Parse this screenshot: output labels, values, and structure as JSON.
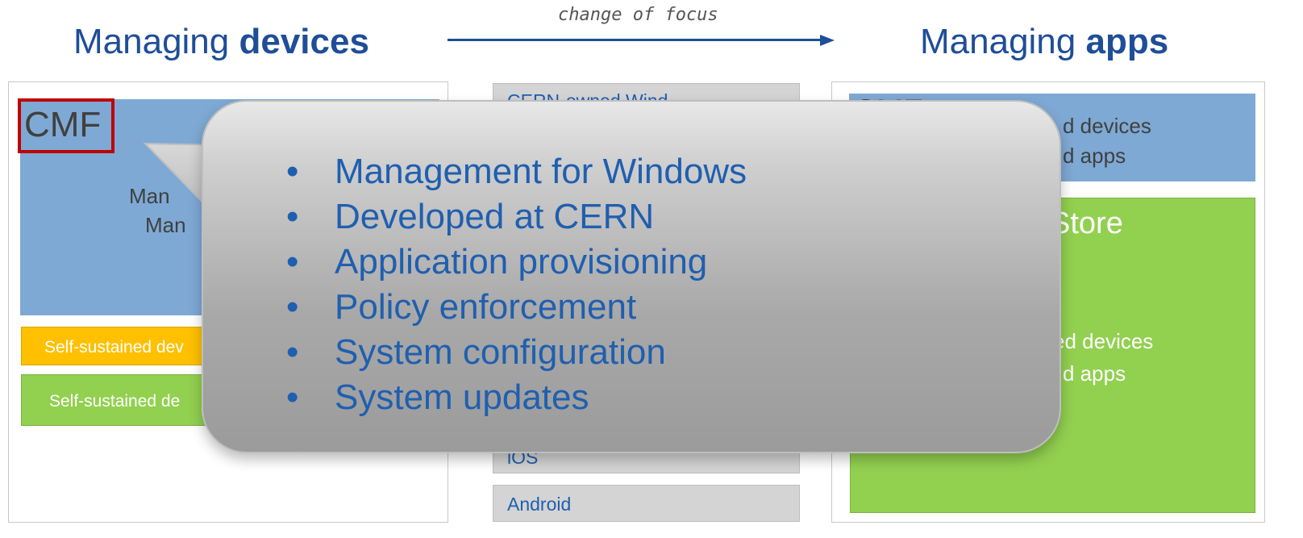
{
  "header": {
    "left_prefix": "Managing ",
    "left_bold": "devices",
    "right_prefix": "Managing ",
    "right_bold": "apps",
    "arrow_label": "change of focus"
  },
  "left_panel": {
    "cmf_label": "CMF",
    "managed_line1": "Man",
    "managed_line2": "Man",
    "orange_bar": "Self-sustained dev",
    "green_bar": "Self-sustained de"
  },
  "middle_column": {
    "top_item": "CERN-owned Wind",
    "ios": "iOS",
    "android": "Android"
  },
  "right_panel": {
    "cmf_label": "CMF",
    "line1": "d devices",
    "line2": "d apps",
    "store_title": "Store",
    "store_line1": "ed devices",
    "store_line2": "d apps"
  },
  "callout": {
    "bullet_glyph": "•",
    "items": [
      "Management for Windows",
      "Developed at CERN",
      "Application provisioning",
      "Policy enforcement",
      "System configuration",
      "System updates"
    ]
  },
  "colors": {
    "heading": "#1f4e98",
    "cmf_blue": "#7ea9d4",
    "orange": "#ffc000",
    "green": "#92d050",
    "gray": "#d4d4d4",
    "highlight_red": "#c00000"
  }
}
